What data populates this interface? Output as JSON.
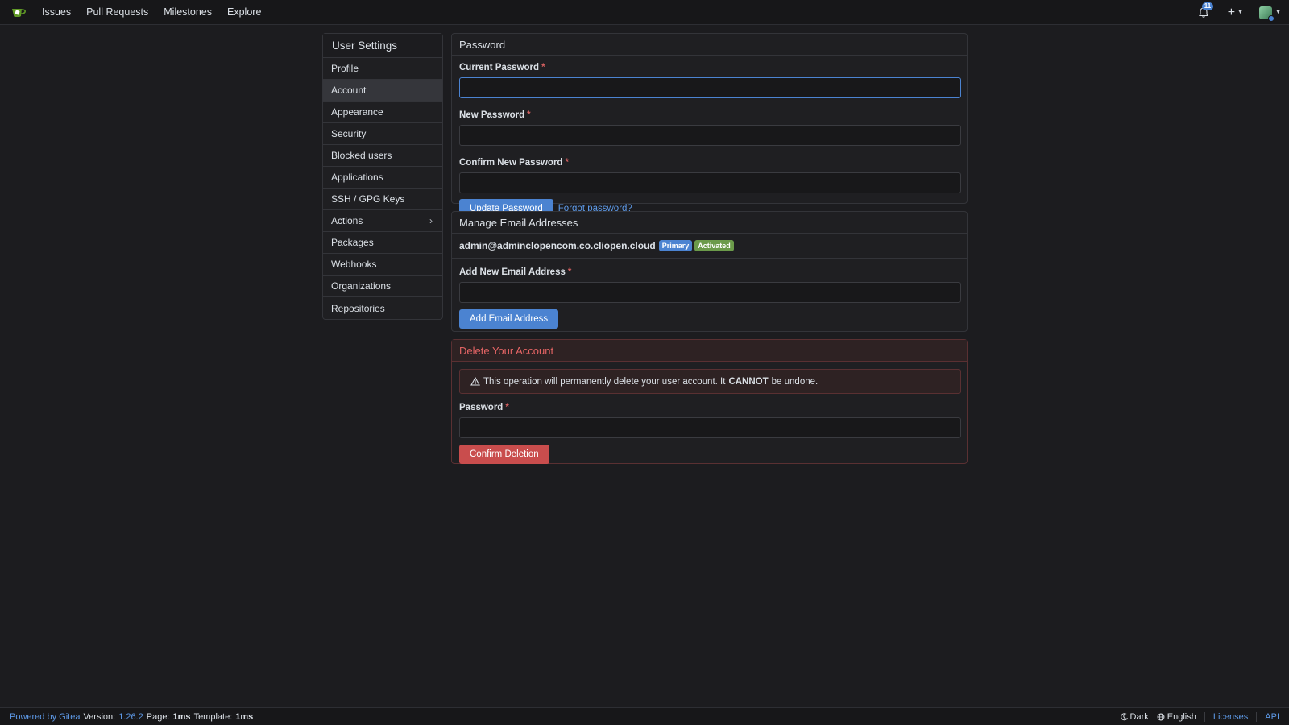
{
  "nav": {
    "links": [
      "Issues",
      "Pull Requests",
      "Milestones",
      "Explore"
    ],
    "notification_count": "11"
  },
  "sidebar": {
    "title": "User Settings",
    "items": [
      {
        "label": "Profile"
      },
      {
        "label": "Account"
      },
      {
        "label": "Appearance"
      },
      {
        "label": "Security"
      },
      {
        "label": "Blocked users"
      },
      {
        "label": "Applications"
      },
      {
        "label": "SSH / GPG Keys"
      },
      {
        "label": "Actions"
      },
      {
        "label": "Packages"
      },
      {
        "label": "Webhooks"
      },
      {
        "label": "Organizations"
      },
      {
        "label": "Repositories"
      }
    ]
  },
  "password": {
    "title": "Password",
    "current_label": "Current Password",
    "new_label": "New Password",
    "confirm_label": "Confirm New Password",
    "update_button": "Update Password",
    "forgot_link": "Forgot password?"
  },
  "email": {
    "title": "Manage Email Addresses",
    "address": "admin@adminclopencom.co.cliopen.cloud",
    "badge_primary": "Primary",
    "badge_activated": "Activated",
    "add_label": "Add New Email Address",
    "add_button": "Add Email Address"
  },
  "delete": {
    "title": "Delete Your Account",
    "warning_pre": "This operation will permanently delete your user account. It",
    "warning_bold": "CANNOT",
    "warning_post": "be undone.",
    "password_label": "Password",
    "confirm_button": "Confirm Deletion"
  },
  "footer": {
    "powered": "Powered by Gitea",
    "version_label": "Version:",
    "version": "1.26.2",
    "page_label": "Page:",
    "page_time": "1ms",
    "template_label": "Template:",
    "template_time": "1ms",
    "theme": "Dark",
    "language": "English",
    "licenses": "Licenses",
    "api": "API"
  },
  "colors": {
    "accent": "#4b83d1",
    "danger": "#c94d4d",
    "success": "#6b9a4a"
  }
}
